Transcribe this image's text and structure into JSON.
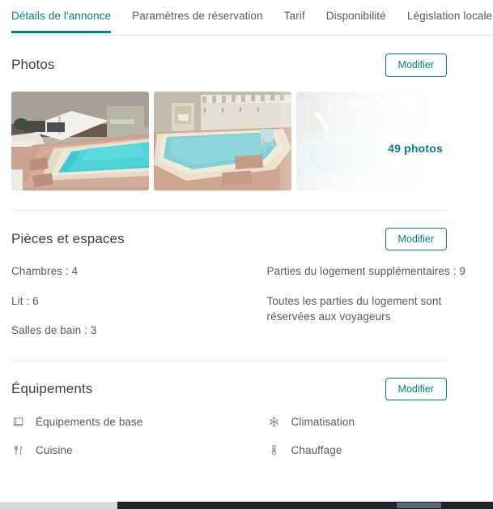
{
  "theme": {
    "accent": "#00848a",
    "text": "#5a5a5a",
    "heading": "#3c4043",
    "divider": "#ebebeb"
  },
  "tabs": [
    {
      "label": "Détails de l'annonce",
      "active": true
    },
    {
      "label": "Paramètres de réservation",
      "active": false
    },
    {
      "label": "Tarif",
      "active": false
    },
    {
      "label": "Disponibilité",
      "active": false
    },
    {
      "label": "Législation locale",
      "active": false
    }
  ],
  "sections": {
    "photos": {
      "title": "Photos",
      "edit_label": "Modifier",
      "count_label": "49 photos",
      "thumbnails": [
        {
          "alt": "Piscine extérieure avec parasol blanc et transats"
        },
        {
          "alt": "Piscine avec mur crénelé et fontaine"
        },
        {
          "alt": "Piscine intérieure éclairée"
        }
      ]
    },
    "rooms": {
      "title": "Pièces et espaces",
      "edit_label": "Modifier",
      "left_facts": [
        "Chambres : 4",
        "Lit : 6",
        "Salles de bain : 3"
      ],
      "right_facts": [
        "Parties du logement supplémentaires : 9",
        "Toutes les parties du logement sont réservées aux voyageurs"
      ]
    },
    "amenities": {
      "title": "Équipements",
      "edit_label": "Modifier",
      "left_items": [
        {
          "icon": "towel-icon",
          "label": "Équipements de base"
        },
        {
          "icon": "cutlery-icon",
          "label": "Cuisine"
        }
      ],
      "right_items": [
        {
          "icon": "snowflake-icon",
          "label": "Climatisation"
        },
        {
          "icon": "thermometer-icon",
          "label": "Chauffage"
        }
      ]
    }
  }
}
